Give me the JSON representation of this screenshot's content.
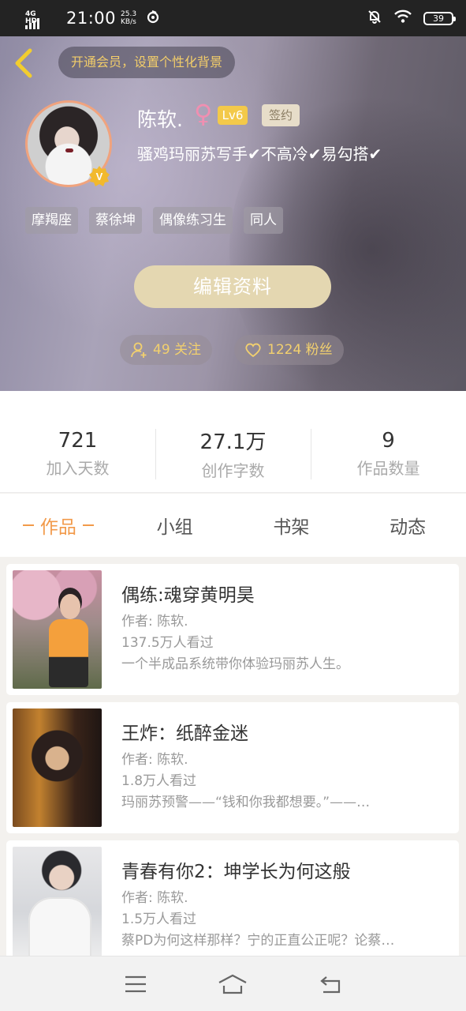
{
  "status_bar": {
    "network": "4G HD",
    "time": "21:00",
    "speed_value": "25.3",
    "speed_unit": "KB/s",
    "battery": "39"
  },
  "header": {
    "vip_banner": "开通会员，设置个性化背景",
    "name": "陈软.",
    "gender_symbol": "♀",
    "level": "Lv6",
    "signed_badge": "签约",
    "bio": "骚鸡玛丽苏写手✔不高冷✔易勾搭✔",
    "tags": [
      "摩羯座",
      "蔡徐坤",
      "偶像练习生",
      "同人"
    ],
    "edit_button": "编辑资料",
    "following": "49 关注",
    "followers": "1224 粉丝",
    "accent_color": "#f2d06e"
  },
  "stats": [
    {
      "value": "721",
      "label": "加入天数"
    },
    {
      "value": "27.1万",
      "label": "创作字数"
    },
    {
      "value": "9",
      "label": "作品数量"
    }
  ],
  "tabs": [
    {
      "label": "作品",
      "active": true
    },
    {
      "label": "小组",
      "active": false
    },
    {
      "label": "书架",
      "active": false
    },
    {
      "label": "动态",
      "active": false
    }
  ],
  "works": [
    {
      "title": "偶练:魂穿黄明昊",
      "author": "作者: 陈软.",
      "views": "137.5万人看过",
      "desc": "一个半成品系统带你体验玛丽苏人生。"
    },
    {
      "title": "王炸：纸醉金迷",
      "author": "作者: 陈软.",
      "views": "1.8万人看过",
      "desc": "玛丽苏预警——“钱和你我都想要。”——…"
    },
    {
      "title": "青春有你2：坤学长为何这般",
      "author": "作者: 陈软.",
      "views": "1.5万人看过",
      "desc": "蔡PD为何这样那样？宁的正直公正呢？论蔡…"
    }
  ],
  "icons": {
    "back": "chevron-left-icon",
    "menu": "menu-icon",
    "home": "home-icon",
    "return": "return-icon"
  }
}
